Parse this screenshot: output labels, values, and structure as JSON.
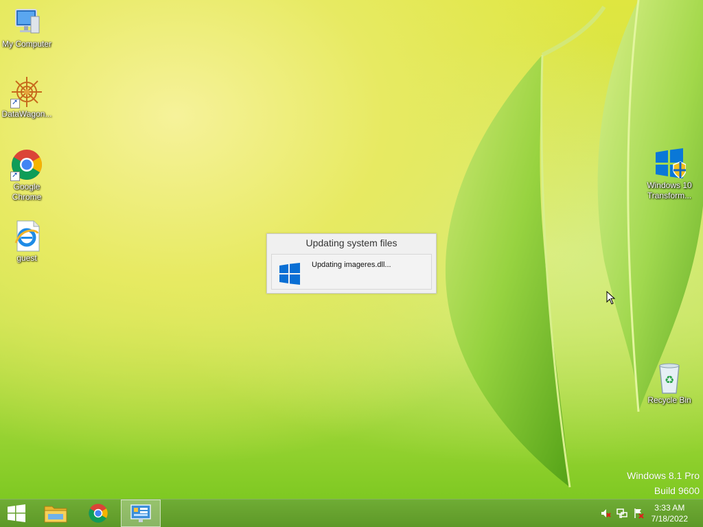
{
  "desktop": {
    "icons_left": [
      {
        "label": "My Computer",
        "icon": "computer-icon"
      },
      {
        "label": "DataWagon...",
        "icon": "datawagon-icon"
      },
      {
        "label": "Google Chrome",
        "icon": "chrome-icon"
      },
      {
        "label": "guest",
        "icon": "internet-explorer-icon"
      }
    ],
    "icons_right": [
      {
        "label": "Windows 10 Transform...",
        "icon": "windows-shield-icon"
      },
      {
        "label": "Recycle Bin",
        "icon": "recycle-bin-icon"
      }
    ],
    "watermark": {
      "line1": "Windows 8.1 Pro",
      "line2": "Build 9600"
    }
  },
  "dialog": {
    "title": "Updating system files",
    "message": "Updating imageres.dll..."
  },
  "taskbar": {
    "pinned": [
      "start-icon",
      "file-explorer-icon",
      "chrome-icon",
      "control-panel-icon"
    ],
    "tray": [
      "volume-muted-icon",
      "network-icon",
      "action-center-flag-icon"
    ],
    "clock": {
      "time": "3:33 AM",
      "date": "7/18/2022"
    }
  },
  "colors": {
    "accent_blue": "#0a6fd4",
    "taskbar": "#6aa63a",
    "wallpaper": "#d6e54a"
  }
}
